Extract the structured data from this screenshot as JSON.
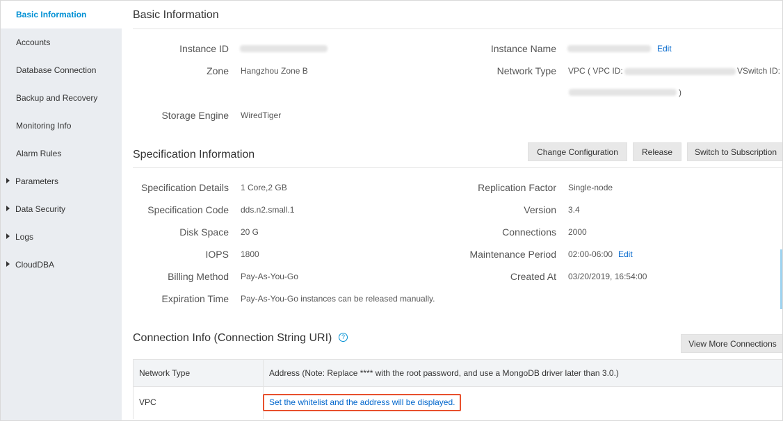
{
  "sidebar": {
    "items": [
      {
        "label": "Basic Information",
        "active": true,
        "expandable": false
      },
      {
        "label": "Accounts",
        "active": false,
        "expandable": false
      },
      {
        "label": "Database Connection",
        "active": false,
        "expandable": false
      },
      {
        "label": "Backup and Recovery",
        "active": false,
        "expandable": false
      },
      {
        "label": "Monitoring Info",
        "active": false,
        "expandable": false
      },
      {
        "label": "Alarm Rules",
        "active": false,
        "expandable": false
      },
      {
        "label": "Parameters",
        "active": false,
        "expandable": true
      },
      {
        "label": "Data Security",
        "active": false,
        "expandable": true
      },
      {
        "label": "Logs",
        "active": false,
        "expandable": true
      },
      {
        "label": "CloudDBA",
        "active": false,
        "expandable": true
      }
    ]
  },
  "basic": {
    "title": "Basic Information",
    "instance_id_label": "Instance ID",
    "instance_name_label": "Instance Name",
    "edit_label": "Edit",
    "zone_label": "Zone",
    "zone_value": "Hangzhou Zone B",
    "network_type_label": "Network Type",
    "network_prefix": "VPC ( VPC ID:",
    "vswitch_label": "VSwitch ID:",
    "network_suffix": ")",
    "storage_engine_label": "Storage Engine",
    "storage_engine_value": "WiredTiger"
  },
  "spec": {
    "title": "Specification Information",
    "buttons": {
      "change": "Change Configuration",
      "release": "Release",
      "subscription": "Switch to Subscription"
    },
    "details_label": "Specification Details",
    "details_value": "1 Core,2 GB",
    "code_label": "Specification Code",
    "code_value": "dds.n2.small.1",
    "disk_label": "Disk Space",
    "disk_value": "20 G",
    "iops_label": "IOPS",
    "iops_value": "1800",
    "billing_label": "Billing Method",
    "billing_value": "Pay-As-You-Go",
    "expiration_label": "Expiration Time",
    "expiration_value": "Pay-As-You-Go instances can be released manually.",
    "replication_label": "Replication Factor",
    "replication_value": "Single-node",
    "version_label": "Version",
    "version_value": "3.4",
    "connections_label": "Connections",
    "connections_value": "2000",
    "maintenance_label": "Maintenance Period",
    "maintenance_value": "02:00-06:00",
    "maintenance_edit": "Edit",
    "created_label": "Created At",
    "created_value": "03/20/2019, 16:54:00"
  },
  "connection": {
    "title": "Connection Info (Connection String URI)",
    "help_icon": "?",
    "view_more": "View More Connections",
    "table": {
      "headers": [
        "Network Type",
        "Address (Note: Replace **** with the root password, and use a MongoDB driver later than 3.0.)"
      ],
      "rows": [
        {
          "network_type": "VPC",
          "address_link": "Set the whitelist and the address will be displayed."
        }
      ]
    }
  },
  "colors": {
    "accent": "#0090d4",
    "link": "#0066cc",
    "highlight_border": "#e8502d",
    "sidebar_bg": "#eaedf1"
  }
}
